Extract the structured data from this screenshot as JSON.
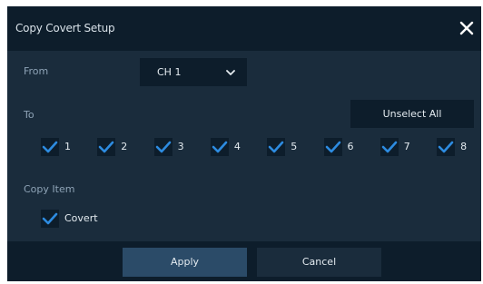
{
  "dialog": {
    "title": "Copy Covert Setup",
    "from_label": "From",
    "from_value": "CH 1",
    "to_label": "To",
    "unselect_all_label": "Unselect All",
    "channels": [
      {
        "label": "1",
        "checked": true
      },
      {
        "label": "2",
        "checked": true
      },
      {
        "label": "3",
        "checked": true
      },
      {
        "label": "4",
        "checked": true
      },
      {
        "label": "5",
        "checked": true
      },
      {
        "label": "6",
        "checked": true
      },
      {
        "label": "7",
        "checked": true
      },
      {
        "label": "8",
        "checked": true
      }
    ],
    "copy_item_label": "Copy Item",
    "copy_items": [
      {
        "label": "Covert",
        "checked": true
      }
    ],
    "apply_label": "Apply",
    "cancel_label": "Cancel"
  },
  "colors": {
    "dialog_bg": "#1a2c3c",
    "panel_dark": "#0d1d2b",
    "apply_bg": "#2b4b68",
    "checkbox_blue": "#2d8be0",
    "label_muted": "#8ea3b6",
    "text": "#e4ebf0"
  }
}
